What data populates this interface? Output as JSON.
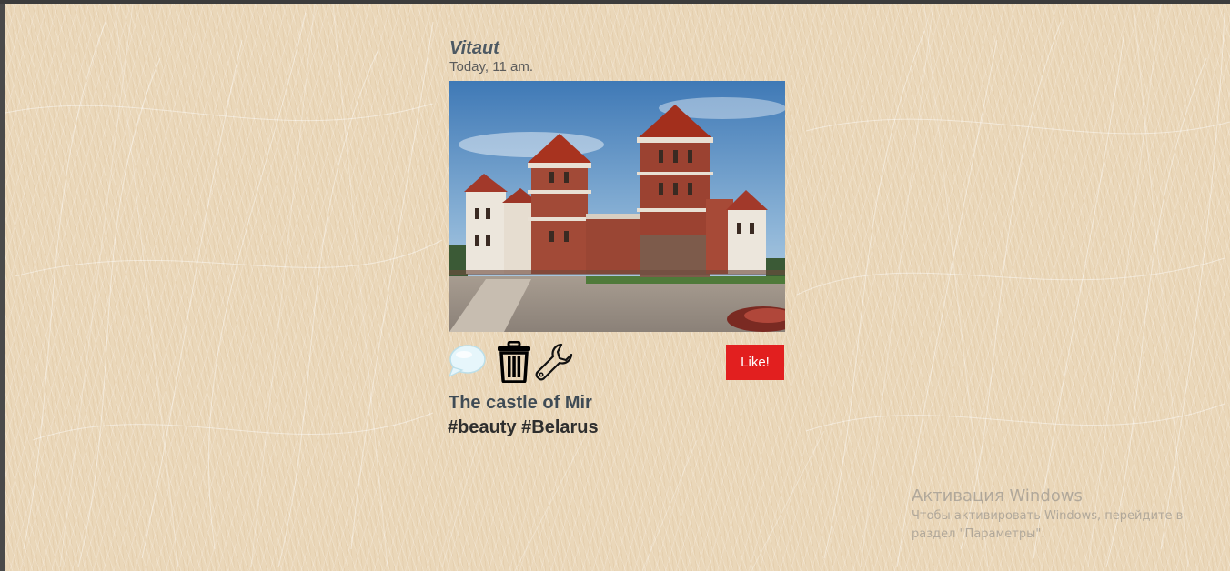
{
  "post": {
    "author": "Vitaut",
    "time": "Today, 11 am.",
    "photo_subject": "Mir Castle",
    "title": "The castle of Mir",
    "tags": "#beauty #Belarus"
  },
  "actions": {
    "comment_icon": "speech-bubble",
    "delete_icon": "trash-can",
    "edit_icon": "wrench",
    "like_label": "Like!"
  },
  "watermark": {
    "title": "Активация Windows",
    "text": "Чтобы активировать Windows, перейдите в раздел \"Параметры\"."
  },
  "colors": {
    "background": "#ead7b9",
    "like_button": "#e21f1f",
    "author": "#4d5963"
  }
}
